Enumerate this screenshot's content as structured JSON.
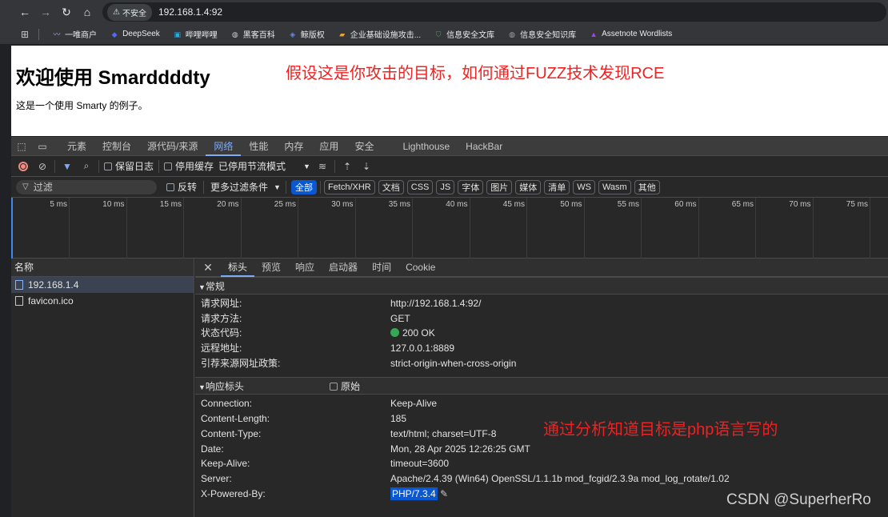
{
  "browser": {
    "security_label": "不安全",
    "url": "192.168.1.4:92",
    "bookmarks": [
      {
        "label": "一唯商户",
        "icon": "wave-icon",
        "color": "#8ab4f8"
      },
      {
        "label": "DeepSeek",
        "icon": "whale-icon",
        "color": "#4d6bfe"
      },
      {
        "label": "哔哩哔哩",
        "icon": "tv-icon",
        "color": "#23ade5"
      },
      {
        "label": "黑客百科",
        "icon": "globe-icon",
        "color": "#c7c7c7"
      },
      {
        "label": "鲸版权",
        "icon": "whale-icon",
        "color": "#5b8def"
      },
      {
        "label": "企业基础设施攻击...",
        "icon": "folder-icon",
        "color": "#e8a33d"
      },
      {
        "label": "信息安全文库",
        "icon": "shield-icon",
        "color": "#34a853"
      },
      {
        "label": "信息安全知识库",
        "icon": "globe-icon",
        "color": "#9aa0a6"
      },
      {
        "label": "Assetnote Wordlists",
        "icon": "triangle-icon",
        "color": "#a142f4"
      }
    ]
  },
  "page": {
    "heading": "欢迎使用 Smarddddty",
    "annotation": "假设这是你攻击的目标，如何通过FUZZ技术发现RCE",
    "text": "这是一个使用 Smarty 的例子。"
  },
  "devtools": {
    "tabs": [
      "元素",
      "控制台",
      "源代码/来源",
      "网络",
      "性能",
      "内存",
      "应用",
      "安全",
      "Lighthouse",
      "HackBar"
    ],
    "active_tab": "网络",
    "toolbar": {
      "preserve_log": "保留日志",
      "disable_cache": "停用缓存",
      "throttle": "已停用节流模式"
    },
    "filter": {
      "placeholder": "过滤",
      "invert": "反转",
      "more_filters": "更多过滤条件",
      "chips": [
        "全部",
        "Fetch/XHR",
        "文档",
        "CSS",
        "JS",
        "字体",
        "图片",
        "媒体",
        "清单",
        "WS",
        "Wasm",
        "其他"
      ],
      "active_chip": "全部"
    },
    "timeline_ticks": [
      "5 ms",
      "10 ms",
      "15 ms",
      "20 ms",
      "25 ms",
      "30 ms",
      "35 ms",
      "40 ms",
      "45 ms",
      "50 ms",
      "55 ms",
      "60 ms",
      "65 ms",
      "70 ms",
      "75 ms"
    ],
    "requests": {
      "header": "名称",
      "items": [
        "192.168.1.4",
        "favicon.ico"
      ]
    },
    "detail_tabs": [
      "标头",
      "预览",
      "响应",
      "启动器",
      "时间",
      "Cookie"
    ],
    "general": {
      "title": "常规",
      "rows": [
        {
          "k": "请求网址:",
          "v": "http://192.168.1.4:92/"
        },
        {
          "k": "请求方法:",
          "v": "GET"
        },
        {
          "k": "状态代码:",
          "v": "200 OK"
        },
        {
          "k": "远程地址:",
          "v": "127.0.0.1:8889"
        },
        {
          "k": "引荐来源网址政策:",
          "v": "strict-origin-when-cross-origin"
        }
      ]
    },
    "response_headers": {
      "title": "响应标头",
      "raw_label": "原始",
      "rows": [
        {
          "k": "Connection:",
          "v": "Keep-Alive"
        },
        {
          "k": "Content-Length:",
          "v": "185"
        },
        {
          "k": "Content-Type:",
          "v": "text/html; charset=UTF-8"
        },
        {
          "k": "Date:",
          "v": "Mon, 28 Apr 2025 12:26:25 GMT"
        },
        {
          "k": "Keep-Alive:",
          "v": "timeout=3600"
        },
        {
          "k": "Server:",
          "v": "Apache/2.4.39 (Win64) OpenSSL/1.1.1b mod_fcgid/2.3.9a mod_log_rotate/1.02"
        },
        {
          "k": "X-Powered-By:",
          "v": "PHP/7.3.4"
        }
      ]
    },
    "annotation": "通过分析知道目标是php语言写的",
    "watermark": "CSDN @SuperherRo"
  }
}
